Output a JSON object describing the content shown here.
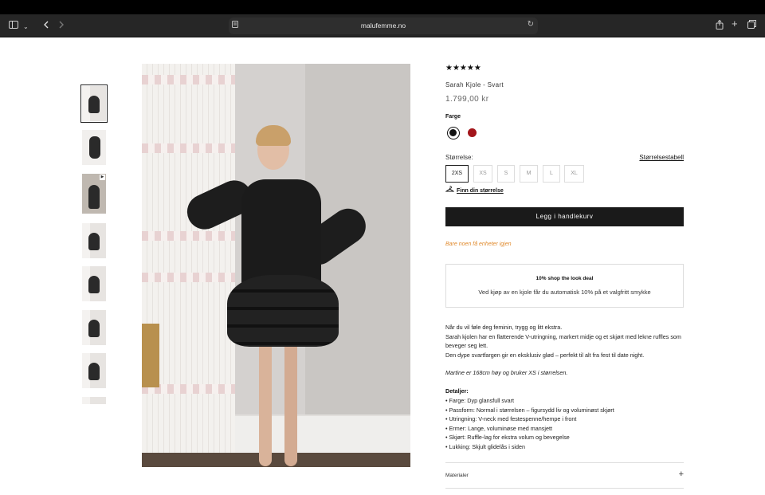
{
  "browser": {
    "url": "malufemme.no",
    "icons": {
      "sidebar": "sidebar-icon",
      "back": "chevron-left-icon",
      "forward": "chevron-right-icon",
      "reader": "reader-icon",
      "reload": "reload-icon",
      "share": "share-icon",
      "new_tab": "plus-icon",
      "tabs": "tabs-icon"
    }
  },
  "gallery": {
    "thumbnail_count": 8,
    "main_image_alt": "Sarah Kjole - Svart"
  },
  "product": {
    "rating_stars": "★★★★★",
    "rating_value": 4.5,
    "title": "Sarah Kjole - Svart",
    "price": "1.799,00 kr",
    "color_label": "Farge",
    "colors": [
      {
        "name": "black",
        "hex": "#111111",
        "selected": true
      },
      {
        "name": "red",
        "hex": "#a3161b",
        "selected": false
      }
    ],
    "size_label": "Størrelse:",
    "size_guide": "Størrelsestabell",
    "sizes": [
      {
        "label": "2XS",
        "selected": true
      },
      {
        "label": "XS",
        "selected": false
      },
      {
        "label": "S",
        "selected": false
      },
      {
        "label": "M",
        "selected": false
      },
      {
        "label": "L",
        "selected": false
      },
      {
        "label": "XL",
        "selected": false
      }
    ],
    "size_finder": "Finn din størrelse",
    "add_to_cart": "Legg i handlekurv",
    "stock_note": "Bare noen få enheter igjen",
    "deal_title": "10% shop the look deal",
    "deal_text": "Ved kjøp av en kjole får du automatisk 10% på et valgfritt smykke",
    "description": [
      "Når du vil føle deg feminin, trygg og litt ekstra.",
      "Sarah kjolen har en flatterende V-utringning, markert midje og et skjørt med lekne ruffles som beveger seg lett.",
      "Den dype svartfargen gir en eksklusiv glød – perfekt til alt fra fest til date night."
    ],
    "model_note": "Martine er 168cm høy og bruker XS i størrelsen.",
    "details_title": "Detaljer:",
    "details": [
      "• Farge: Dyp glansfull svart",
      "• Passform: Normal i størrelsen – figursydd liv og voluminøst skjørt",
      "• Utringning: V-neck med festespenne/hempe i front",
      "• Ermer: Lange, voluminøse med mansjett",
      "• Skjørt: Ruffle-lag for ekstra volum og bevegelse",
      "• Lukking: Skjult glidelås i siden"
    ],
    "accordion_label": "Materialer",
    "accordion_icon": "+"
  },
  "colors": {
    "button_bg": "#1a1a1a",
    "stock_text": "#e08a2c"
  }
}
